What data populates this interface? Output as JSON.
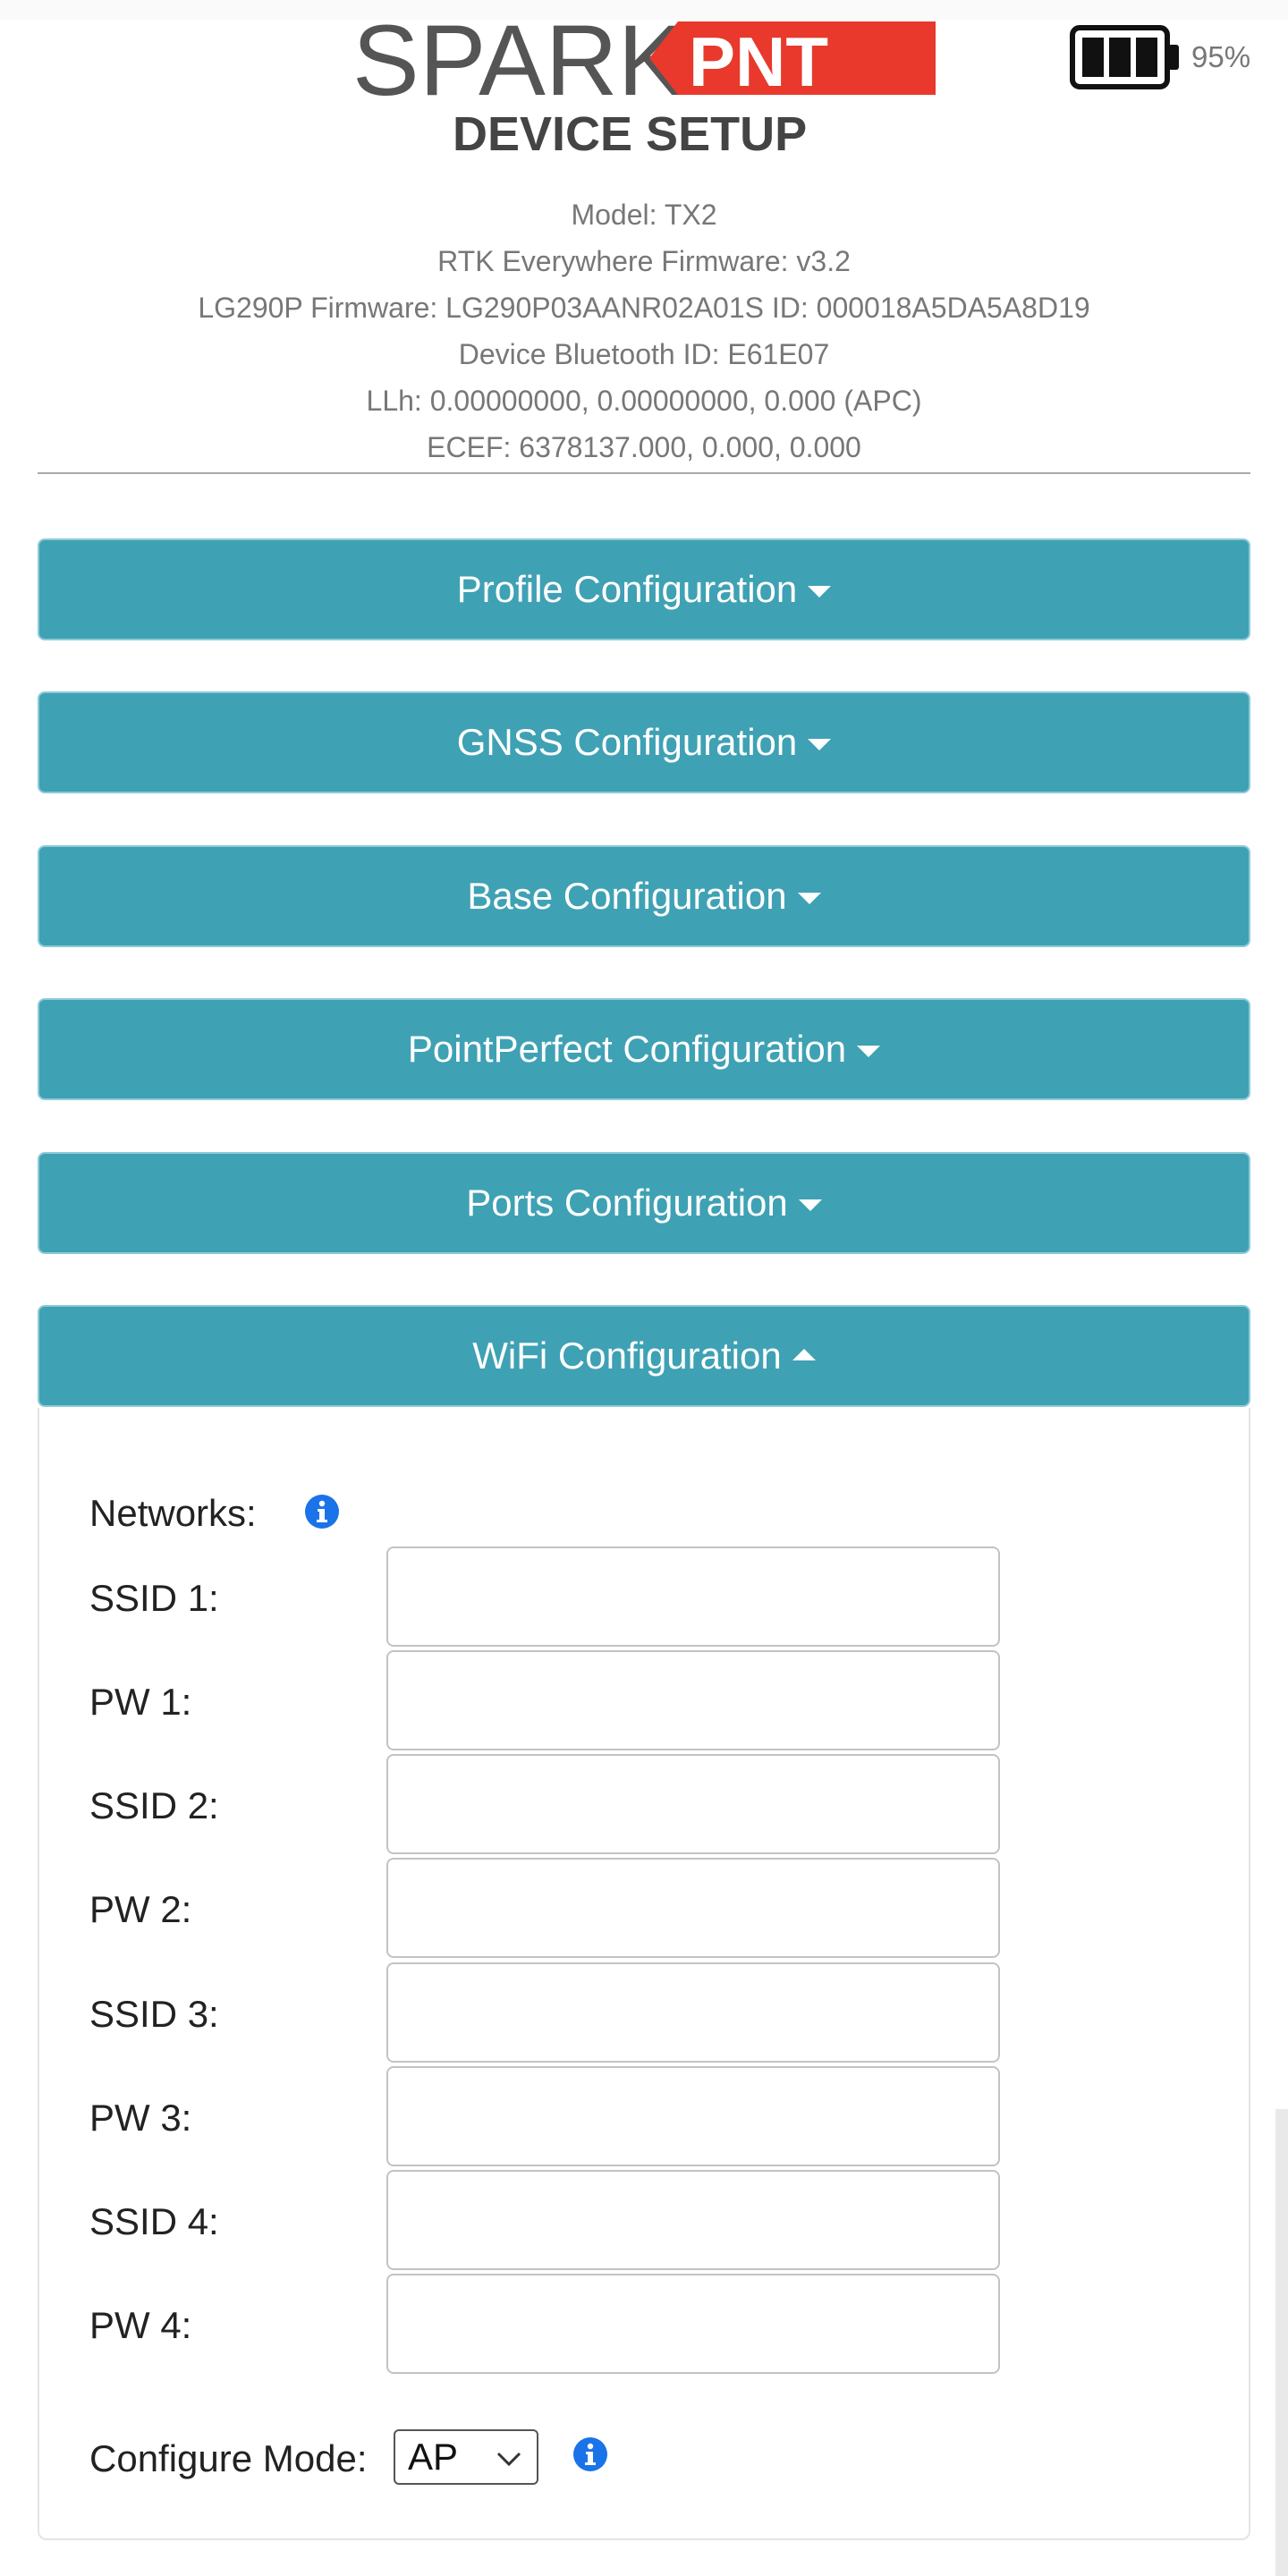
{
  "brand": {
    "logo_main": "SPARK",
    "logo_badge": "PNT",
    "logo_subtitle": "DEVICE SETUP"
  },
  "battery": {
    "level_percent": 95,
    "label": "95%",
    "icon": "battery-icon"
  },
  "device_info": [
    "Model: TX2",
    "RTK Everywhere Firmware: v3.2",
    "LG290P Firmware: LG290P03AANR02A01S ID: 000018A5DA5A8D19",
    "Device Bluetooth ID: E61E07",
    "LLh: 0.00000000, 0.00000000, 0.000 (APC)",
    "ECEF: 6378137.000, 0.000, 0.000"
  ],
  "sections": [
    {
      "label": "Profile Configuration",
      "expanded": false
    },
    {
      "label": "GNSS Configuration",
      "expanded": false
    },
    {
      "label": "Base Configuration",
      "expanded": false
    },
    {
      "label": "PointPerfect Configuration",
      "expanded": false
    },
    {
      "label": "Ports Configuration",
      "expanded": false
    },
    {
      "label": "WiFi Configuration",
      "expanded": true
    }
  ],
  "wifi": {
    "networks_label": "Networks:",
    "fields": [
      {
        "label": "SSID 1:",
        "value": ""
      },
      {
        "label": "PW 1:",
        "value": ""
      },
      {
        "label": "SSID 2:",
        "value": ""
      },
      {
        "label": "PW 2:",
        "value": ""
      },
      {
        "label": "SSID 3:",
        "value": ""
      },
      {
        "label": "PW 3:",
        "value": ""
      },
      {
        "label": "SSID 4:",
        "value": ""
      },
      {
        "label": "PW 4:",
        "value": ""
      }
    ],
    "configure_mode_label": "Configure Mode:",
    "configure_mode_value": "AP"
  },
  "colors": {
    "section_button": "#3fa1b4",
    "brand_red": "#e8392c",
    "brand_gray": "#555555",
    "info_icon": "#1a73e8"
  },
  "icons": {
    "section_collapsed": "caret-down-icon",
    "section_expanded": "caret-up-icon",
    "info": "info-icon",
    "select": "chevron-down-icon"
  }
}
